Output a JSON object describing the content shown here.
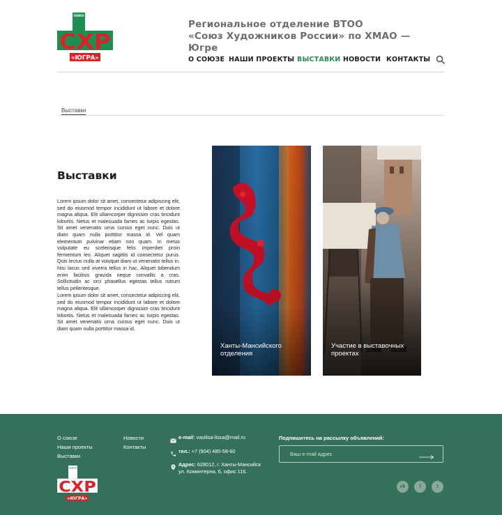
{
  "header": {
    "logo": {
      "top_text": "СОЮЗ ХУДОЖНИКОВ РОССИИ",
      "letters": "СХР",
      "region": "«ЮГРА»"
    },
    "org_title_line1": "Региональное отделение ВТОО",
    "org_title_line2": "«Союз Художников России» по ХМАО — Югре",
    "nav": [
      {
        "label": "О СОЮЗЕ",
        "active": false
      },
      {
        "label": "НАШИ ПРОЕКТЫ",
        "active": false
      },
      {
        "label": "ВЫСТАВКИ",
        "active": true
      },
      {
        "label": "НОВОСТИ",
        "active": false
      },
      {
        "label": "КОНТАКТЫ",
        "active": false
      }
    ],
    "search_icon": "search-icon"
  },
  "breadcrumb": "Выставки",
  "main": {
    "title": "Выставки",
    "paragraph1": "Lorem ipsum dolor sit amet, consectetur adipiscing elit, sed do eiusmod tempor incididunt ut labore et dolore magna aliqua. Elit ullamcorper dignissim cras tincidunt lobortis. Netus et malesuada fames ac turpis egestas. Sit amet venenatis urna cursus eget nunc. Duis ut diam quam nulla porttitor massa id. Vel quam elementum pulvinar etiam non quam. In metus vulputate eu scelerisque felis imperdiet proin fermentum leo. Aliquet sagittis id consectetur purus. Quis lectus nulla at volutpat diam ut venenatis tellus in. Nisi lacus sed viverra tellus in hac. Aliquet bibendum enim facilisis gravida neque convallis a cras. Sollicitudin ac orci phasellus egestas tellus rutrum tellus pellentesque.",
    "paragraph2": "Lorem ipsum dolor sit amet, consectetur adipiscing elit, sed do eiusmod tempor incididunt ut labore et dolore magna aliqua. Elit ullamcorper dignissim cras tincidunt lobortis. Netus et malesuada fames ac turpis egestas. Sit amet venenatis urna cursus eget nunc. Duis ut diam quam nulla porttitor massa id.",
    "cards": [
      {
        "label": "Ханты-Мансийского отделения"
      },
      {
        "label": "Участие в выставочных проектах"
      }
    ]
  },
  "footer": {
    "links_col1": [
      "О союзе",
      "Наши проекты",
      "Выставки"
    ],
    "links_col2": [
      "Новости",
      "Контакты"
    ],
    "email_label": "e-mail:",
    "email_value": "vasilisa-lissa@mail.ru",
    "phone_label": "тел.:",
    "phone_value": "+7 (904) 480-58-60",
    "address_label": "Адрес:",
    "address_line1": "628012, г. Ханты-Мансийск",
    "address_line2": "ул. Коминтерна, 6, офис 116.",
    "subscribe_title": "Подпишитесь на рассылку объявлений:",
    "subscribe_placeholder": "Ваш e-mail адрес",
    "social": [
      {
        "icon": "vk-icon",
        "glyph": "vk"
      },
      {
        "icon": "facebook-icon",
        "glyph": "f"
      },
      {
        "icon": "twitter-icon",
        "glyph": "t"
      }
    ]
  },
  "colors": {
    "brand_green": "#35705a",
    "nav_active": "#2e8a59",
    "logo_red": "#d9232a",
    "logo_green": "#1e8f52"
  }
}
